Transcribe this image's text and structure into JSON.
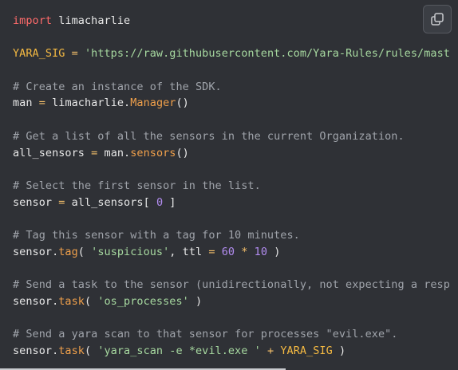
{
  "code": {
    "line1": {
      "kw": "import",
      "rest": " limacharlie"
    },
    "line3": {
      "name": "YARA_SIG",
      "op": " = ",
      "str": "'https://raw.githubusercontent.com/Yara-Rules/rules/mast"
    },
    "line5": "# Create an instance of the SDK.",
    "line6": {
      "a": "man",
      "op": " = ",
      "b": "limacharlie.",
      "fn": "Manager",
      "c": "()"
    },
    "line8": "# Get a list of all the sensors in the current Organization.",
    "line9": {
      "a": "all_sensors",
      "op": " = ",
      "b": "man.",
      "fn": "sensors",
      "c": "()"
    },
    "line11": "# Select the first sensor in the list.",
    "line12": {
      "a": "sensor",
      "op": " = ",
      "b": "all_sensors[ ",
      "num": "0",
      "c": " ]"
    },
    "line14": "# Tag this sensor with a tag for 10 minutes.",
    "line15": {
      "a": "sensor.",
      "fn": "tag",
      "b": "( ",
      "str": "'suspicious'",
      "c": ", ttl ",
      "op": "=",
      "num1": "60",
      "op2": "*",
      "num2": "10",
      "d": " )"
    },
    "line17": "# Send a task to the sensor (unidirectionally, not expecting a resp",
    "line18": {
      "a": "sensor.",
      "fn": "task",
      "b": "( ",
      "str": "'os_processes'",
      "c": " )"
    },
    "line20": "# Send a yara scan to that sensor for processes \"evil.exe\".",
    "line21": {
      "a": "sensor.",
      "fn": "task",
      "b": "( ",
      "str": "'yara_scan -e *evil.exe '",
      "op": "+",
      "const": "YARA_SIG",
      "c": " )"
    }
  },
  "copy_button": {
    "icon": "copy-icon"
  },
  "colors": {
    "background": "#2f3136",
    "keyword": "#ff6b6b",
    "constant": "#f4b942",
    "comment": "#a0a4ab",
    "string": "#a7d9a0",
    "function": "#f0a04b",
    "number": "#b28cf0"
  }
}
